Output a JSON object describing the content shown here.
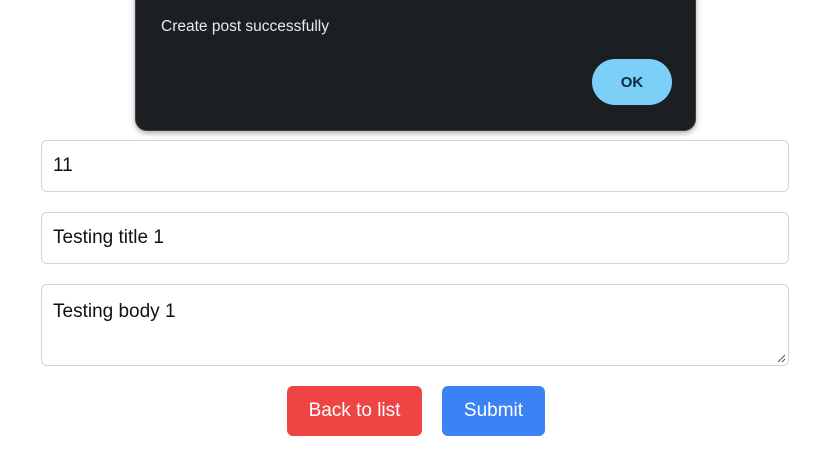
{
  "dialog": {
    "message": "Create post successfully",
    "ok_label": "OK",
    "background_color": "#1b1f22",
    "ok_color": "#7cd0f8"
  },
  "form": {
    "id_value": "11",
    "title_value": "Testing title 1",
    "body_value": "Testing body 1"
  },
  "actions": {
    "back_label": "Back to list",
    "submit_label": "Submit",
    "back_color": "#ef4444",
    "submit_color": "#3b82f6"
  },
  "icons": {
    "resize": "resize-handle-icon"
  }
}
